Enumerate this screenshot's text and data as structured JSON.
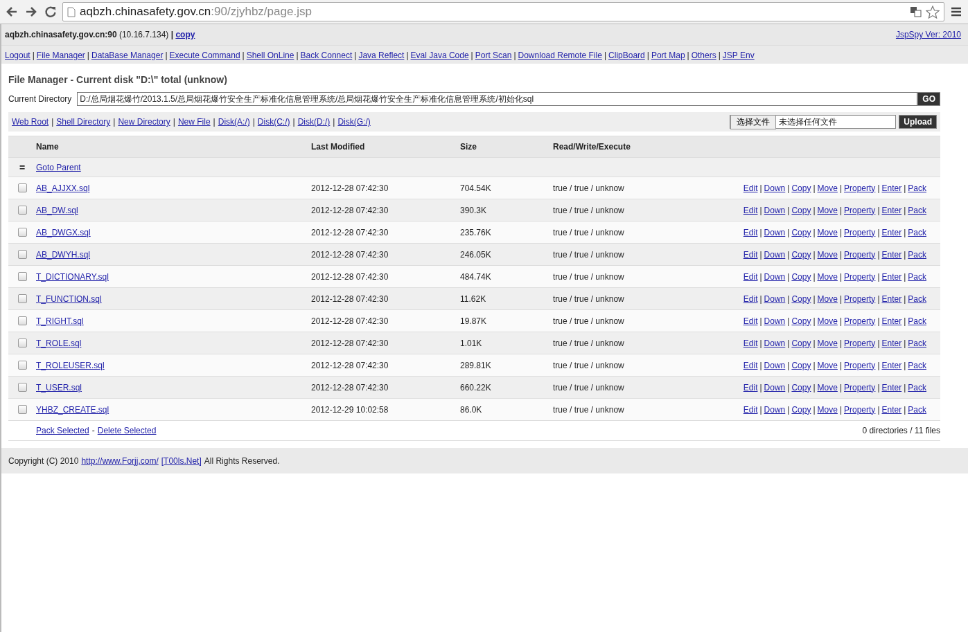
{
  "browser": {
    "url_host": "aqbzh.chinasafety.gov.cn",
    "url_path": ":90/zjyhbz/page.jsp"
  },
  "header": {
    "host": "aqbzh.chinasafety.gov.cn:90",
    "ip": "(10.16.7.134)",
    "separator": "|",
    "copy_link": "copy",
    "version": "JspSpy Ver: 2010"
  },
  "nav": {
    "separator": "|",
    "items": [
      "Logout",
      "File Manager",
      "DataBase Manager",
      "Execute Command",
      "Shell OnLine",
      "Back Connect",
      "Java Reflect",
      "Eval Java Code",
      "Port Scan",
      "Download Remote File",
      "ClipBoard",
      "Port Map",
      "Others",
      "JSP Env"
    ]
  },
  "file_manager": {
    "title": "File Manager - Current disk \"D:\\\" total (unknow)",
    "directory_label": "Current Directory",
    "directory_value": "D:/总局烟花爆竹/2013.1.5/总局烟花爆竹安全生产标准化信息管理系统/总局烟花爆竹安全生产标准化信息管理系统/初始化sql",
    "go_button": "GO",
    "shortcuts": {
      "separator": "|",
      "items": [
        "Web Root",
        "Shell Directory",
        "New Directory",
        "New File",
        "Disk(A:/)",
        "Disk(C:/)",
        "Disk(D:/)",
        "Disk(G:/)"
      ]
    },
    "upload": {
      "choose_button": "选择文件",
      "no_file": "未选择任何文件",
      "upload_button": "Upload"
    }
  },
  "table": {
    "columns": [
      "Name",
      "Last Modified",
      "Size",
      "Read/Write/Execute"
    ],
    "parent": {
      "icon": "=",
      "label": "Goto Parent"
    },
    "action_separator": "|",
    "rows": [
      {
        "checked": false,
        "name": "AB_AJJXX.sql",
        "modified": "2012-12-28 07:42:30",
        "size": "704.54K",
        "rwx": "true / true / unknow",
        "actions": [
          "Edit",
          "Down",
          "Copy",
          "Move",
          "Property",
          "Enter",
          "Pack"
        ]
      },
      {
        "checked": false,
        "name": "AB_DW.sql",
        "modified": "2012-12-28 07:42:30",
        "size": "390.3K",
        "rwx": "true / true / unknow",
        "actions": [
          "Edit",
          "Down",
          "Copy",
          "Move",
          "Property",
          "Enter",
          "Pack"
        ]
      },
      {
        "checked": false,
        "name": "AB_DWGX.sql",
        "modified": "2012-12-28 07:42:30",
        "size": "235.76K",
        "rwx": "true / true / unknow",
        "actions": [
          "Edit",
          "Down",
          "Copy",
          "Move",
          "Property",
          "Enter",
          "Pack"
        ]
      },
      {
        "checked": false,
        "name": "AB_DWYH.sql",
        "modified": "2012-12-28 07:42:30",
        "size": "246.05K",
        "rwx": "true / true / unknow",
        "actions": [
          "Edit",
          "Down",
          "Copy",
          "Move",
          "Property",
          "Enter",
          "Pack"
        ]
      },
      {
        "checked": false,
        "name": "T_DICTIONARY.sql",
        "modified": "2012-12-28 07:42:30",
        "size": "484.74K",
        "rwx": "true / true / unknow",
        "actions": [
          "Edit",
          "Down",
          "Copy",
          "Move",
          "Property",
          "Enter",
          "Pack"
        ]
      },
      {
        "checked": false,
        "name": "T_FUNCTION.sql",
        "modified": "2012-12-28 07:42:30",
        "size": "11.62K",
        "rwx": "true / true / unknow",
        "actions": [
          "Edit",
          "Down",
          "Copy",
          "Move",
          "Property",
          "Enter",
          "Pack"
        ]
      },
      {
        "checked": false,
        "name": "T_RIGHT.sql",
        "modified": "2012-12-28 07:42:30",
        "size": "19.87K",
        "rwx": "true / true / unknow",
        "actions": [
          "Edit",
          "Down",
          "Copy",
          "Move",
          "Property",
          "Enter",
          "Pack"
        ]
      },
      {
        "checked": false,
        "name": "T_ROLE.sql",
        "modified": "2012-12-28 07:42:30",
        "size": "1.01K",
        "rwx": "true / true / unknow",
        "actions": [
          "Edit",
          "Down",
          "Copy",
          "Move",
          "Property",
          "Enter",
          "Pack"
        ]
      },
      {
        "checked": false,
        "name": "T_ROLEUSER.sql",
        "modified": "2012-12-28 07:42:30",
        "size": "289.81K",
        "rwx": "true / true / unknow",
        "actions": [
          "Edit",
          "Down",
          "Copy",
          "Move",
          "Property",
          "Enter",
          "Pack"
        ]
      },
      {
        "checked": false,
        "name": "T_USER.sql",
        "modified": "2012-12-28 07:42:30",
        "size": "660.22K",
        "rwx": "true / true / unknow",
        "actions": [
          "Edit",
          "Down",
          "Copy",
          "Move",
          "Property",
          "Enter",
          "Pack"
        ]
      },
      {
        "checked": false,
        "name": "YHBZ_CREATE.sql",
        "modified": "2012-12-29 10:02:58",
        "size": "86.0K",
        "rwx": "true / true / unknow",
        "actions": [
          "Edit",
          "Down",
          "Copy",
          "Move",
          "Property",
          "Enter",
          "Pack"
        ]
      }
    ],
    "footer": {
      "pack_selected": "Pack Selected",
      "separator": "-",
      "delete_selected": "Delete Selected",
      "summary": "0 directories / 11 files"
    }
  },
  "copyright": {
    "prefix": "Copyright (C) 2010",
    "link1": "http://www.Forjj.com/",
    "link2": "[T00ls.Net]",
    "suffix": "All Rights Reserved."
  }
}
